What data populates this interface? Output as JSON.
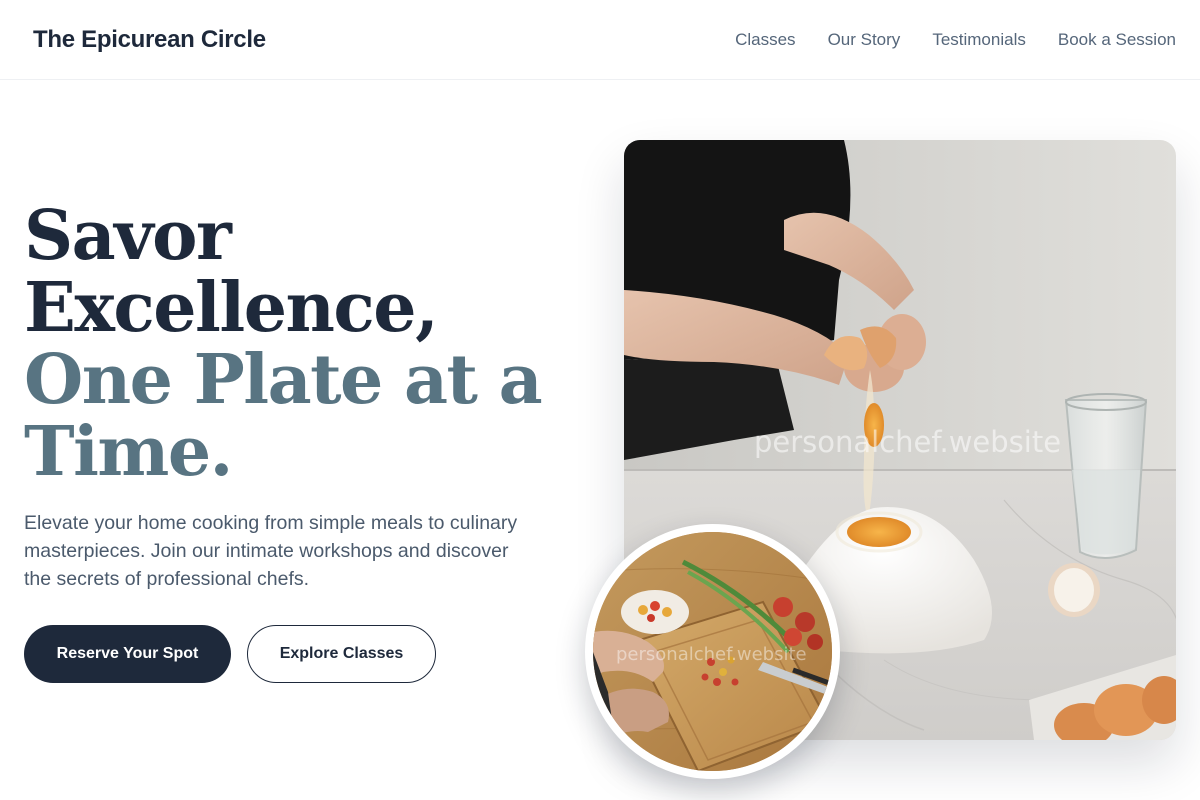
{
  "brand": {
    "name": "The Epicurean Circle"
  },
  "nav": {
    "links": [
      {
        "label": "Classes"
      },
      {
        "label": "Our Story"
      },
      {
        "label": "Testimonials"
      },
      {
        "label": "Book a Session"
      }
    ]
  },
  "hero": {
    "title_line_1": "Savor",
    "title_line_2": "Excellence,",
    "title_line_3": "One Plate at a",
    "title_line_4": "Time.",
    "subtitle": "Elevate your home cooking from simple meals to culinary masterpieces. Join our intimate workshops and discover the secrets of professional chefs.",
    "primary_button": "Reserve Your Spot",
    "secondary_button": "Explore Classes"
  },
  "images": {
    "main_photo": "hands cracking egg over flour on marble counter",
    "circle_photo": "chopping cherry tomatoes on wooden cutting board",
    "watermark": "personalchef.website"
  },
  "colors": {
    "primary": "#1e293b",
    "accent_muted": "#587482",
    "body_text": "#4b5a6c",
    "nav_text": "#55667a"
  }
}
